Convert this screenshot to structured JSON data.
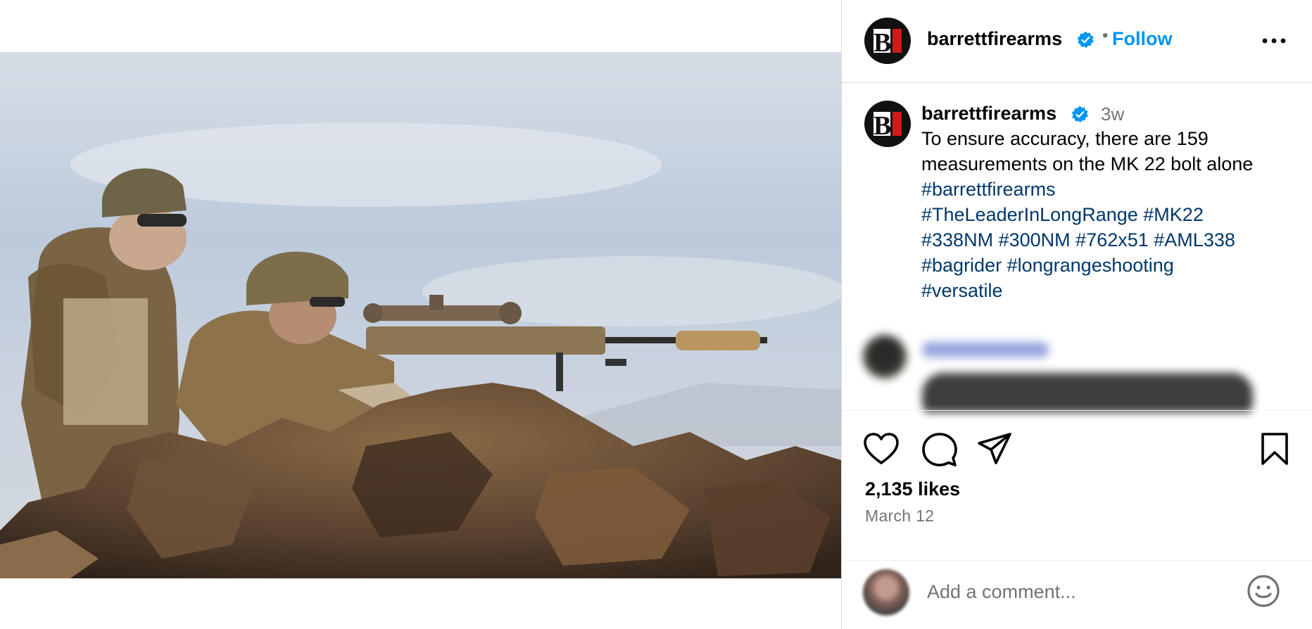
{
  "header": {
    "username": "barrettfirearms",
    "follow_label": "Follow",
    "dot": "•",
    "more_icon": "more-horizontal-icon",
    "avatar_logo_letter": "B"
  },
  "caption": {
    "username": "barrettfirearms",
    "time": "3w",
    "text": "To ensure accuracy, there are 159 measurements on the MK 22 bolt alone",
    "hashtag_lines": [
      [
        "#barrettfirearms"
      ],
      [
        "#TheLeaderInLongRange",
        "#MK22"
      ],
      [
        "#338NM",
        "#300NM",
        "#762x51",
        "#AML338"
      ],
      [
        "#bagrider",
        "#longrangeshooting"
      ],
      [
        "#versatile"
      ]
    ]
  },
  "actions": {
    "like_icon": "heart-icon",
    "comment_icon": "comment-bubble-icon",
    "share_icon": "paper-plane-icon",
    "save_icon": "bookmark-icon"
  },
  "likes_text": "2,135 likes",
  "date_text": "March 12",
  "comment_input": {
    "placeholder": "Add a comment...",
    "emoji_icon": "smiley-icon"
  },
  "colors": {
    "follow": "#0095f6",
    "hashtag": "#00376b",
    "verified": "#0095f6",
    "muted": "#737373"
  }
}
